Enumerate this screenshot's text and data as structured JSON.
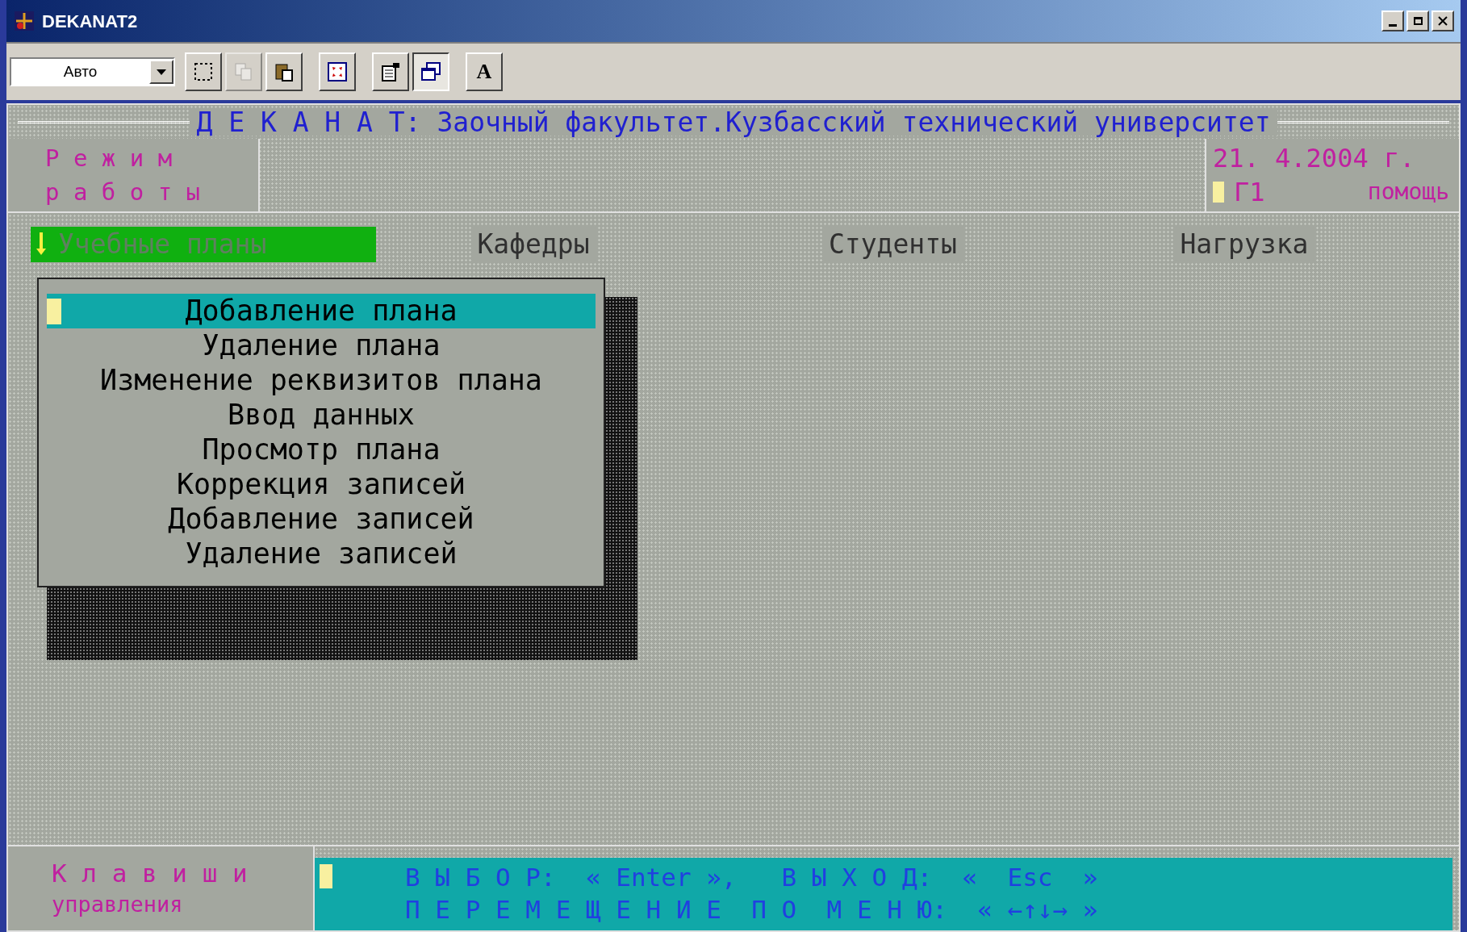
{
  "window": {
    "title": "DEKANAT2"
  },
  "toolbar": {
    "combo": "Авто",
    "buttons": [
      {
        "kind": "select",
        "pressed": false,
        "disabled": false
      },
      {
        "kind": "copy",
        "pressed": false,
        "disabled": true
      },
      {
        "kind": "paste",
        "pressed": false,
        "disabled": false
      },
      {
        "kind": "fullscreen",
        "pressed": false,
        "disabled": false
      },
      {
        "kind": "properties",
        "pressed": false,
        "disabled": false
      },
      {
        "kind": "background",
        "pressed": true,
        "disabled": false
      },
      {
        "kind": "font",
        "pressed": false,
        "disabled": false,
        "label": "A"
      }
    ]
  },
  "header": {
    "title": "Д Е К А Н А Т: Заочный факультет.Кузбасский технический университет",
    "mode_label": [
      "Р е ж и м",
      "р а б о т ы"
    ],
    "date": "21. 4.2004 г.",
    "help_key": "Г1",
    "help_label": "помощь"
  },
  "menu": [
    {
      "label": "Учебные планы",
      "selected": true
    },
    {
      "label": "Кафедры",
      "selected": false
    },
    {
      "label": "Студенты",
      "selected": false
    },
    {
      "label": "Нагрузка",
      "selected": false
    }
  ],
  "submenu": [
    {
      "label": "Добавление плана",
      "selected": true
    },
    {
      "label": "Удаление плана",
      "selected": false
    },
    {
      "label": "Изменение реквизитов плана",
      "selected": false
    },
    {
      "label": "Ввод данных",
      "selected": false
    },
    {
      "label": "Просмотр плана",
      "selected": false
    },
    {
      "label": "Коррекция записей",
      "selected": false
    },
    {
      "label": "Добавление записей",
      "selected": false
    },
    {
      "label": "Удаление записей",
      "selected": false
    }
  ],
  "keys": {
    "label": [
      "К л а в и ш и",
      "управления"
    ],
    "hints": [
      "В Ы Б О Р:  « Enter »,   В Ы Х О Д:  «  Esc  »",
      "П Е Р Е М Е Щ Е Н И Е  П О  М Е Н Ю:  « ←↑↓→ »"
    ]
  }
}
